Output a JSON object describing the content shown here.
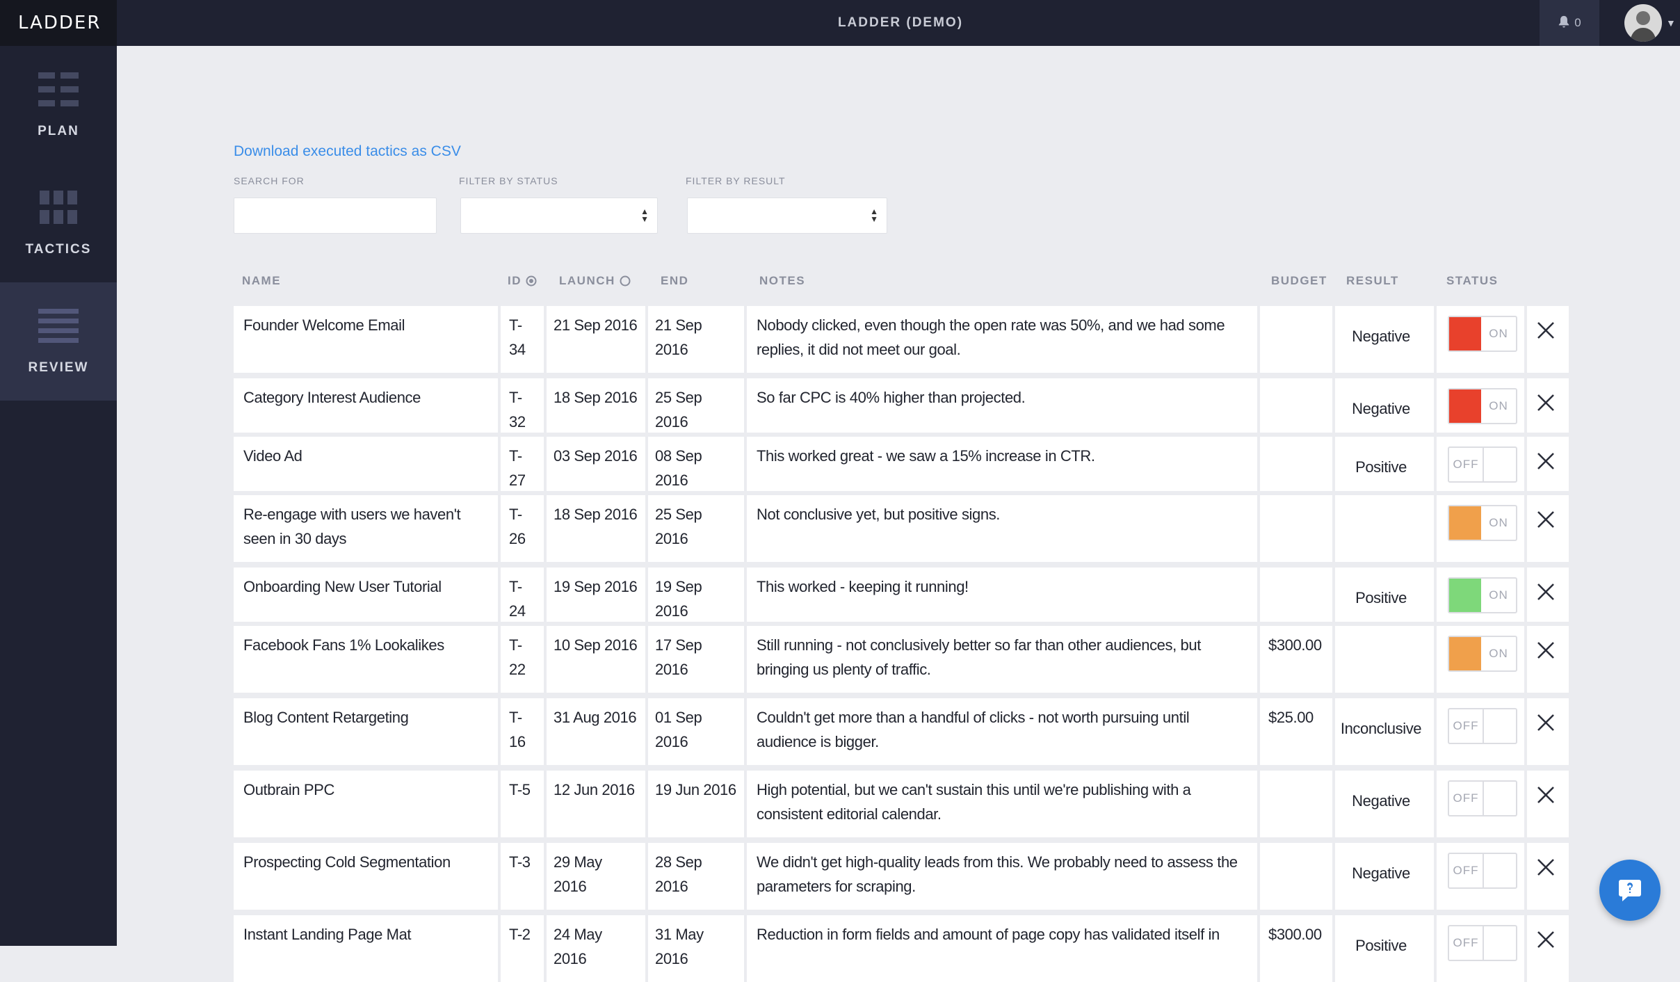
{
  "app": {
    "logo": "LADDER",
    "title": "LADDER (DEMO)",
    "notification_count": "0"
  },
  "sidebar": {
    "items": [
      {
        "label": "PLAN",
        "icon": "plan-grid-icon",
        "active": false
      },
      {
        "label": "TACTICS",
        "icon": "tactics-grid-icon",
        "active": false
      },
      {
        "label": "REVIEW",
        "icon": "review-list-icon",
        "active": true
      }
    ]
  },
  "toolbar": {
    "csv_link": "Download executed tactics as CSV",
    "search_label": "SEARCH FOR",
    "search_value": "",
    "status_filter_label": "FILTER BY STATUS",
    "status_filter_value": "",
    "result_filter_label": "FILTER BY RESULT",
    "result_filter_value": ""
  },
  "table": {
    "columns": {
      "name": "NAME",
      "id": "ID",
      "launch": "LAUNCH",
      "end": "END",
      "notes": "NOTES",
      "budget": "BUDGET",
      "result": "RESULT",
      "status": "STATUS"
    },
    "rows": [
      {
        "name": "Founder Welcome Email",
        "id": "T-34",
        "launch": "21 Sep 2016",
        "end": "21 Sep 2016",
        "notes": "Nobody clicked, even though the open rate was 50%, and we had some replies, it did not meet our goal.",
        "budget": "",
        "result": "Negative",
        "status": "ON",
        "status_color": "#e8412c"
      },
      {
        "name": "Category Interest Audience",
        "id": "T-32",
        "launch": "18 Sep 2016",
        "end": "25 Sep 2016",
        "notes": "So far CPC is 40% higher than projected.",
        "budget": "",
        "result": "Negative",
        "status": "ON",
        "status_color": "#e8412c"
      },
      {
        "name": "Video Ad",
        "id": "T-27",
        "launch": "03 Sep 2016",
        "end": "08 Sep 2016",
        "notes": "This worked great - we saw a 15% increase in CTR.",
        "budget": "",
        "result": "Positive",
        "status": "OFF",
        "status_color": ""
      },
      {
        "name": "Re-engage with users we haven't seen in 30 days",
        "id": "T-26",
        "launch": "18 Sep 2016",
        "end": "25 Sep 2016",
        "notes": "Not conclusive yet, but positive signs.",
        "budget": "",
        "result": "",
        "status": "ON",
        "status_color": "#f0a04b"
      },
      {
        "name": "Onboarding New User Tutorial",
        "id": "T-24",
        "launch": "19 Sep 2016",
        "end": "19 Sep 2016",
        "notes": "This worked - keeping it running!",
        "budget": "",
        "result": "Positive",
        "status": "ON",
        "status_color": "#7ed87a"
      },
      {
        "name": "Facebook Fans 1% Lookalikes",
        "id": "T-22",
        "launch": "10 Sep 2016",
        "end": "17 Sep 2016",
        "notes": "Still running - not conclusively better so far than other audiences, but bringing us plenty of traffic.",
        "budget": "$300.00",
        "result": "",
        "status": "ON",
        "status_color": "#f0a04b"
      },
      {
        "name": "Blog Content Retargeting",
        "id": "T-16",
        "launch": "31 Aug 2016",
        "end": "01 Sep 2016",
        "notes": "Couldn't get more than a handful of clicks - not worth pursuing until audience is bigger.",
        "budget": "$25.00",
        "result": "Inconclusive",
        "status": "OFF",
        "status_color": ""
      },
      {
        "name": "Outbrain PPC",
        "id": "T-5",
        "launch": "12 Jun 2016",
        "end": "19 Jun 2016",
        "notes": "High potential, but we can't sustain this until we're publishing with a consistent editorial calendar.",
        "budget": "",
        "result": "Negative",
        "status": "OFF",
        "status_color": ""
      },
      {
        "name": "Prospecting Cold Segmentation",
        "id": "T-3",
        "launch": "29 May 2016",
        "end": "28 Sep 2016",
        "notes": "We didn't get high-quality leads from this. We probably need to assess the parameters for scraping.",
        "budget": "",
        "result": "Negative",
        "status": "OFF",
        "status_color": ""
      },
      {
        "name": "Instant Landing Page Mat",
        "id": "T-2",
        "launch": "24 May 2016",
        "end": "31 May 2016",
        "notes": "Reduction in form fields and amount of page copy has validated itself in",
        "budget": "$300.00",
        "result": "Positive",
        "status": "OFF",
        "status_color": ""
      }
    ]
  }
}
